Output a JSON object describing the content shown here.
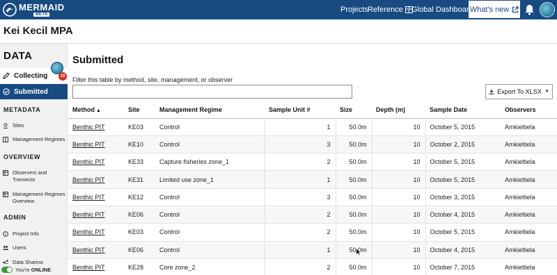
{
  "brand": {
    "name": "MERMAID",
    "badge": "BETA"
  },
  "nav": {
    "projects": "Projects",
    "reference": "Reference",
    "global_dashboard": "Global Dashboard",
    "whats_new": "What's new"
  },
  "project": {
    "title": "Kei Kecil MPA"
  },
  "sidebar": {
    "data_heading": "DATA",
    "collecting": "Collecting",
    "collecting_badge": "10",
    "submitted": "Submitted",
    "metadata_heading": "METADATA",
    "metadata_items": [
      "Sites",
      "Management Regimes"
    ],
    "overview_heading": "OVERVIEW",
    "overview_items": [
      "Observers and Transects",
      "Management Regimes Overview"
    ],
    "admin_heading": "ADMIN",
    "admin_items": [
      "Project Info",
      "Users",
      "Data Sharing"
    ],
    "status_prefix": "You're",
    "status_value": "ONLINE"
  },
  "main": {
    "title": "Submitted",
    "filter_label": "Filter this table by method, site, management, or observer",
    "filter_value": "",
    "export_label": "Export To XLSX"
  },
  "table": {
    "headers": [
      "Method",
      "Site",
      "Management Regime",
      "Sample Unit #",
      "Size",
      "Depth (m)",
      "Sample Date",
      "Observers"
    ],
    "sorted_column": "Method",
    "sort_direction": "ascending",
    "rows": [
      [
        "Benthic PIT",
        "KE03",
        "Control",
        "1",
        "50.0m",
        "10",
        "October 5, 2015",
        "Amkieltiela"
      ],
      [
        "Benthic PIT",
        "KE10",
        "Control",
        "3",
        "50.0m",
        "10",
        "October 2, 2015",
        "Amkieltiela"
      ],
      [
        "Benthic PIT",
        "KE33",
        "Capture fisheries zone_1",
        "2",
        "50.0m",
        "10",
        "October 5, 2015",
        "Amkieltiela"
      ],
      [
        "Benthic PIT",
        "KE31",
        "Limited use zone_1",
        "1",
        "50.0m",
        "10",
        "October 5, 2015",
        "Amkieltiela"
      ],
      [
        "Benthic PIT",
        "KE12",
        "Control",
        "3",
        "50.0m",
        "10",
        "October 3, 2015",
        "Amkieltiela"
      ],
      [
        "Benthic PIT",
        "KE06",
        "Control",
        "2",
        "50.0m",
        "10",
        "October 4, 2015",
        "Amkieltiela"
      ],
      [
        "Benthic PIT",
        "KE03",
        "Control",
        "2",
        "50.0m",
        "10",
        "October 5, 2015",
        "Amkieltiela"
      ],
      [
        "Benthic PIT",
        "KE06",
        "Control",
        "1",
        "50.0m",
        "10",
        "October 4, 2015",
        "Amkieltiela"
      ],
      [
        "Benthic PIT",
        "KE28",
        "Core zone_2",
        "2",
        "50.0m",
        "10",
        "October 7, 2015",
        "Amkieltiela"
      ]
    ]
  },
  "colors": {
    "brand_blue": "#174b82",
    "badge_red": "#d93025",
    "online_green": "#3a9a3a"
  }
}
